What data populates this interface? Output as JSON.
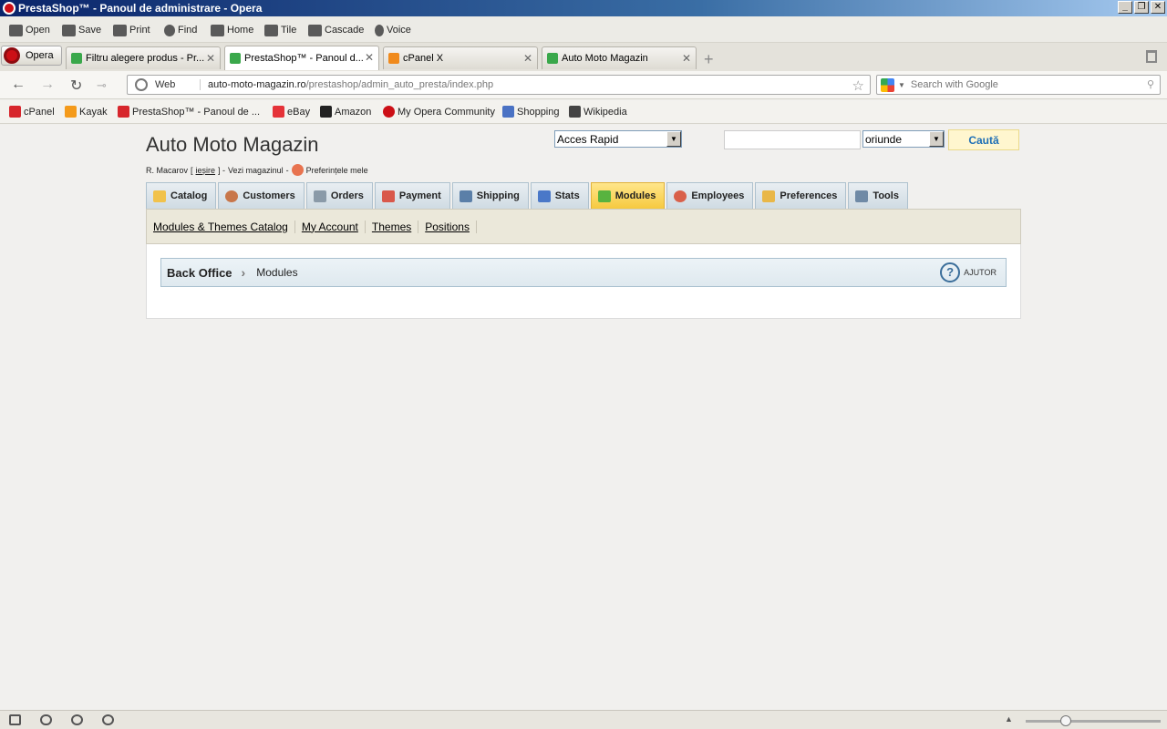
{
  "window": {
    "title": "PrestaShop™ - Panoul de administrare - Opera",
    "buttons": [
      "_",
      "❐",
      "✕"
    ]
  },
  "toolbar": {
    "items": [
      {
        "label": "Open",
        "icon": "folder-icon"
      },
      {
        "label": "Save",
        "icon": "save-icon"
      },
      {
        "label": "Print",
        "icon": "print-icon"
      },
      {
        "label": "Find",
        "icon": "find-icon"
      },
      {
        "label": "Home",
        "icon": "home-icon"
      },
      {
        "label": "Tile",
        "icon": "tile-icon"
      },
      {
        "label": "Cascade",
        "icon": "cascade-icon"
      },
      {
        "label": "Voice",
        "icon": "voice-icon"
      }
    ]
  },
  "browser_tabs": {
    "opera_label": "Opera",
    "tabs": [
      {
        "label": "Filtru alegere produs - Pr...",
        "color": "#3aa84b",
        "active": false
      },
      {
        "label": "PrestaShop™ - Panoul d...",
        "color": "#3aa84b",
        "active": true
      },
      {
        "label": "cPanel X",
        "color": "#f08a1c",
        "active": false
      },
      {
        "label": "Auto Moto Magazin",
        "color": "#3aa84b",
        "active": false
      }
    ],
    "new_tab": "+"
  },
  "address": {
    "scope": "Web",
    "url_host": "auto-moto-magazin.ro",
    "url_path": "/prestashop/admin_auto_presta/index.php",
    "search_placeholder": "Search with Google"
  },
  "bookmarks": [
    {
      "label": "cPanel",
      "color": "#d7262c"
    },
    {
      "label": "Kayak",
      "color": "#f49a1a"
    },
    {
      "label": "PrestaShop™ - Panoul de ...",
      "color": "#d7262c"
    },
    {
      "label": "eBay",
      "color": "#e53238"
    },
    {
      "label": "Amazon",
      "color": "#222222"
    },
    {
      "label": "My Opera Community",
      "color": "#cc0f16"
    },
    {
      "label": "Shopping",
      "color": "#4a72c4"
    },
    {
      "label": "Wikipedia",
      "color": "#444444"
    }
  ],
  "header": {
    "shop_name": "Auto Moto Magazin",
    "user_name": "R. Macarov",
    "logout_label": "ieșire",
    "view_shop": "Vezi magazinul",
    "preferences": "Preferințele mele",
    "quick_access": "Acces Rapid",
    "search_scope": "oriunde",
    "search_button": "Caută"
  },
  "nav": {
    "tabs": [
      {
        "label": "Catalog",
        "color": "#f1c24b",
        "active": false
      },
      {
        "label": "Customers",
        "color": "#c8764a",
        "active": false
      },
      {
        "label": "Orders",
        "color": "#8a9aa8",
        "active": false
      },
      {
        "label": "Payment",
        "color": "#d9584b",
        "active": false
      },
      {
        "label": "Shipping",
        "color": "#5b7fa8",
        "active": false
      },
      {
        "label": "Stats",
        "color": "#4a78c8",
        "active": false
      },
      {
        "label": "Modules",
        "color": "#58b33f",
        "active": true
      },
      {
        "label": "Employees",
        "color": "#d9604a",
        "active": false
      },
      {
        "label": "Preferences",
        "color": "#e9b748",
        "active": false
      },
      {
        "label": "Tools",
        "color": "#6f8aa6",
        "active": false
      }
    ]
  },
  "subnav": {
    "links": [
      "Modules & Themes Catalog",
      "My Account",
      "Themes",
      "Positions"
    ]
  },
  "breadcrumb": {
    "root": "Back Office",
    "current": "Modules",
    "help_label": "AJUTOR"
  }
}
